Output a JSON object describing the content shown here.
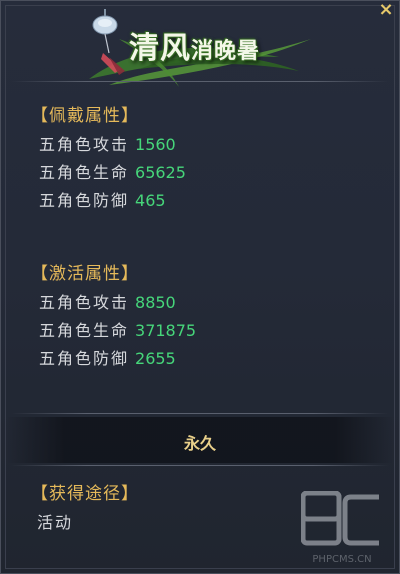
{
  "item": {
    "title_main": "清风",
    "title_tail": "消晚暑",
    "close_symbol": "×"
  },
  "worn_attributes": {
    "header": "【佩戴属性】",
    "stats": [
      {
        "name": "五角色攻击",
        "value": "1560"
      },
      {
        "name": "五角色生命",
        "value": "65625"
      },
      {
        "name": "五角色防御",
        "value": "465"
      }
    ]
  },
  "activation_attributes": {
    "header": "【激活属性】",
    "stats": [
      {
        "name": "五角色攻击",
        "value": "8850"
      },
      {
        "name": "五角色生命",
        "value": "371875"
      },
      {
        "name": "五角色防御",
        "value": "2655"
      }
    ]
  },
  "duration": "永久",
  "acquisition": {
    "header": "【获得途径】",
    "source": "活动"
  },
  "watermark": {
    "logo_text": "PC",
    "caption": "PHPCMS.CN"
  },
  "colors": {
    "panel_bg": "#242a38",
    "header_gold": "#e5b95a",
    "value_green": "#46d67a",
    "text_light": "#d6d8dc",
    "duration_gold": "#e8cf8a"
  }
}
